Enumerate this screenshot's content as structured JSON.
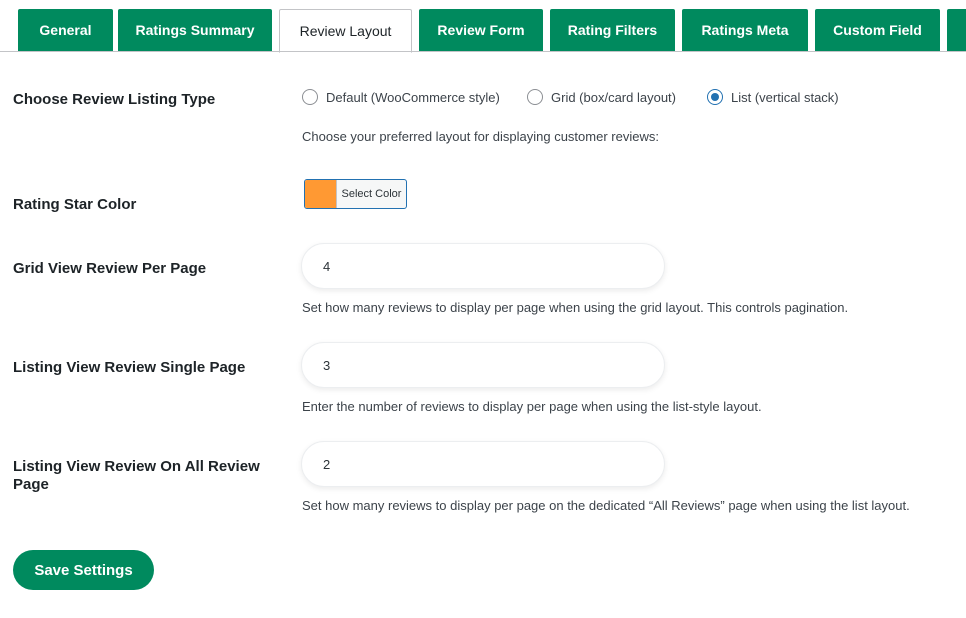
{
  "tabs": [
    {
      "label": "General",
      "active": false
    },
    {
      "label": "Ratings Summary",
      "active": false
    },
    {
      "label": "Review Layout",
      "active": true
    },
    {
      "label": "Review Form",
      "active": false
    },
    {
      "label": "Rating Filters",
      "active": false
    },
    {
      "label": "Ratings Meta",
      "active": false
    },
    {
      "label": "Custom Field",
      "active": false
    }
  ],
  "listing_type": {
    "label": "Choose Review Listing Type",
    "options": [
      {
        "label": "Default (WooCommerce style)",
        "checked": false
      },
      {
        "label": "Grid (box/card layout)",
        "checked": false
      },
      {
        "label": "List (vertical stack)",
        "checked": true
      }
    ],
    "description": "Choose your preferred layout for displaying customer reviews:"
  },
  "star_color": {
    "label": "Rating Star Color",
    "button_label": "Select Color",
    "value": "#ff9933"
  },
  "grid_per_page": {
    "label": "Grid View Review Per Page",
    "value": "4",
    "description": "Set how many reviews to display per page when using the grid layout. This controls pagination."
  },
  "list_single_page": {
    "label": "Listing View Review Single Page",
    "value": "3",
    "description": "Enter the number of reviews to display per page when using the list-style layout."
  },
  "list_all_reviews": {
    "label": "Listing View Review On All Review Page",
    "value": "2",
    "description": "Set how many reviews to display per page on the dedicated “All Reviews” page when using the list layout."
  },
  "save_label": "Save Settings",
  "colors": {
    "accent": "#008a5e",
    "radio_checked": "#2271b1"
  }
}
